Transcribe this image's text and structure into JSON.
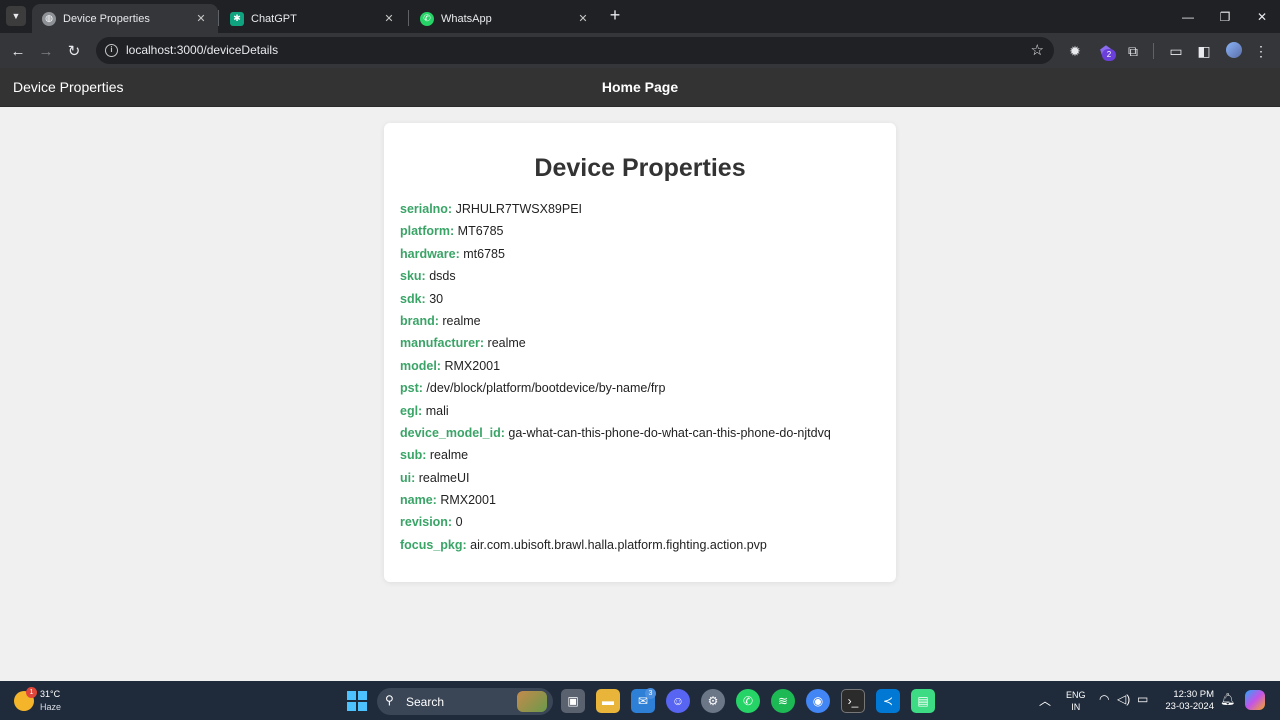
{
  "browser": {
    "tabs": [
      {
        "title": "Device Properties",
        "active": true,
        "favicon": "globe-icon",
        "close": "✕"
      },
      {
        "title": "ChatGPT",
        "active": false,
        "favicon": "chatgpt-icon",
        "close": "✕"
      },
      {
        "title": "WhatsApp",
        "active": false,
        "favicon": "whatsapp-icon",
        "close": "✕"
      }
    ],
    "new_tab": "+",
    "url": "localhost:3000/deviceDetails",
    "extension_badge": "2"
  },
  "app": {
    "brand": "Device Properties",
    "home_link": "Home Page"
  },
  "card": {
    "title": "Device Properties",
    "properties": [
      {
        "key": "serialno:",
        "value": "JRHULR7TWSX89PEI"
      },
      {
        "key": "platform:",
        "value": "MT6785"
      },
      {
        "key": "hardware:",
        "value": "mt6785"
      },
      {
        "key": "sku:",
        "value": "dsds"
      },
      {
        "key": "sdk:",
        "value": "30"
      },
      {
        "key": "brand:",
        "value": "realme"
      },
      {
        "key": "manufacturer:",
        "value": "realme"
      },
      {
        "key": "model:",
        "value": "RMX2001"
      },
      {
        "key": "pst:",
        "value": "/dev/block/platform/bootdevice/by-name/frp"
      },
      {
        "key": "egl:",
        "value": "mali"
      },
      {
        "key": "device_model_id:",
        "value": "ga-what-can-this-phone-do-what-can-this-phone-do-njtdvq"
      },
      {
        "key": "sub:",
        "value": "realme"
      },
      {
        "key": "ui:",
        "value": "realmeUI"
      },
      {
        "key": "name:",
        "value": "RMX2001"
      },
      {
        "key": "revision:",
        "value": "0"
      },
      {
        "key": "focus_pkg:",
        "value": "air.com.ubisoft.brawl.halla.platform.fighting.action.pvp"
      }
    ]
  },
  "taskbar": {
    "weather": {
      "temp": "31°C",
      "desc": "Haze",
      "alert": "1"
    },
    "search_label": "Search",
    "mail_badge": "3",
    "lang": {
      "line1": "ENG",
      "line2": "IN"
    },
    "clock": {
      "time": "12:30 PM",
      "date": "23-03-2024"
    }
  },
  "colors": {
    "key_text": "#3aa467",
    "navbar_bg": "#333333",
    "page_bg": "#f0f0f0",
    "card_bg": "#ffffff"
  }
}
